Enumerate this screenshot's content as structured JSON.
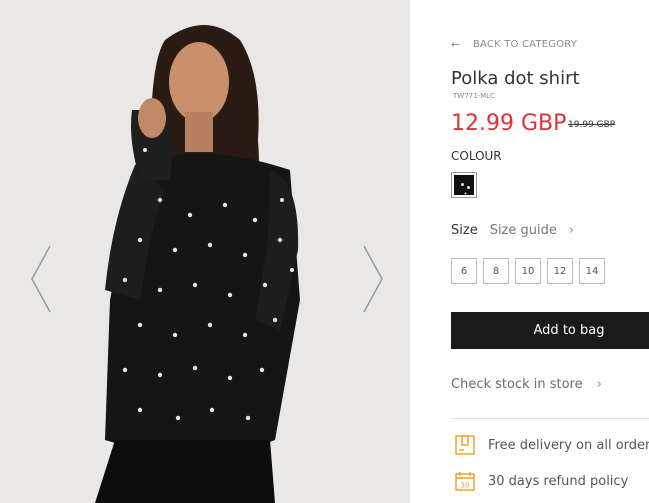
{
  "product": {
    "back_label": "BACK TO CATEGORY",
    "name": "Polka dot shirt",
    "sku": "TW771-MLC",
    "price": "12.99 GBP",
    "old_price": "19.99 GBP",
    "colour_label": "COLOUR",
    "swatch_color": "#111111",
    "size_label": "Size",
    "size_guide_label": "Size guide",
    "sizes": [
      "6",
      "8",
      "10",
      "12",
      "14"
    ],
    "add_to_bag_label": "Add to bag",
    "check_stock_label": "Check stock in store",
    "features": [
      {
        "icon": "delivery-box-icon",
        "text": "Free delivery on all orders"
      },
      {
        "icon": "calendar-30-icon",
        "text": "30 days refund policy"
      }
    ]
  },
  "colors": {
    "price": "#e0303a",
    "button_bg": "#1a1a1a",
    "icon_accent": "#e8a020",
    "photo_bg": "#e9e8e6"
  },
  "gallery": {
    "prev_icon": "chevron-left-icon",
    "next_icon": "chevron-right-icon"
  }
}
